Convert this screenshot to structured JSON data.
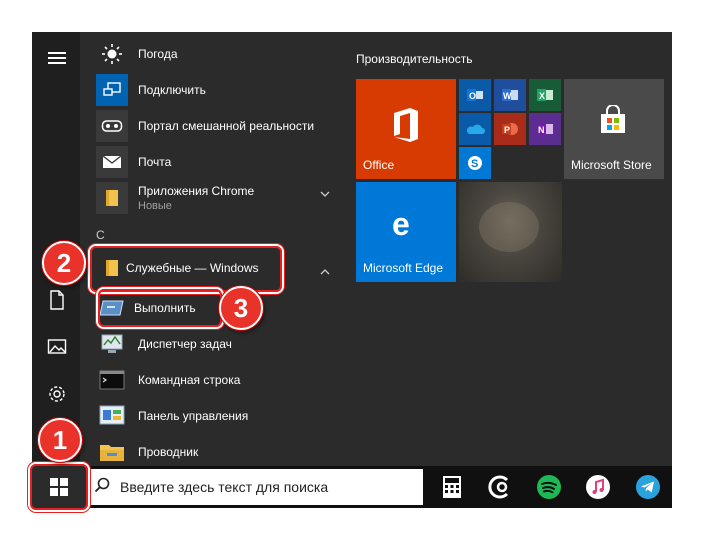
{
  "colors": {
    "office": "#d83b01",
    "edge": "#0078d7",
    "store_tile": "#4a4a4a",
    "highlight": "#e62020"
  },
  "rail": {
    "icons": [
      "hamburger-icon",
      "document-icon",
      "pictures-icon",
      "gear-icon"
    ]
  },
  "apps": {
    "items": [
      {
        "label": "Погода",
        "icon": "sun-icon"
      },
      {
        "label": "Подключить",
        "icon": "connect-icon"
      },
      {
        "label": "Портал смешанной реальности",
        "icon": "headset-icon"
      },
      {
        "label": "Почта",
        "icon": "mail-icon"
      },
      {
        "label": "Приложения Chrome",
        "sub": "Новые",
        "icon": "folder-icon"
      }
    ],
    "section_letter": "С",
    "folder_label": "Служебные — Windows",
    "sub_items": [
      {
        "label": "Выполнить",
        "icon": "run-icon"
      },
      {
        "label": "Диспетчер задач",
        "icon": "task-manager-icon"
      },
      {
        "label": "Командная строка",
        "icon": "cmd-icon"
      },
      {
        "label": "Панель управления",
        "icon": "control-panel-icon"
      },
      {
        "label": "Проводник",
        "icon": "explorer-icon"
      }
    ]
  },
  "tiles": {
    "group_title": "Производительность",
    "office": "Office",
    "store": "Microsoft Store",
    "edge": "Microsoft Edge",
    "mini_icons": [
      "outlook-icon",
      "word-icon",
      "excel-icon",
      "onedrive-icon",
      "powerpoint-icon",
      "onenote-icon",
      "skype-icon"
    ]
  },
  "taskbar": {
    "search_placeholder": "Введите здесь текст для поиска",
    "icons": [
      "calculator-icon",
      "app-icon",
      "spotify-icon",
      "itunes-icon",
      "telegram-icon"
    ]
  },
  "badges": [
    "1",
    "2",
    "3"
  ]
}
